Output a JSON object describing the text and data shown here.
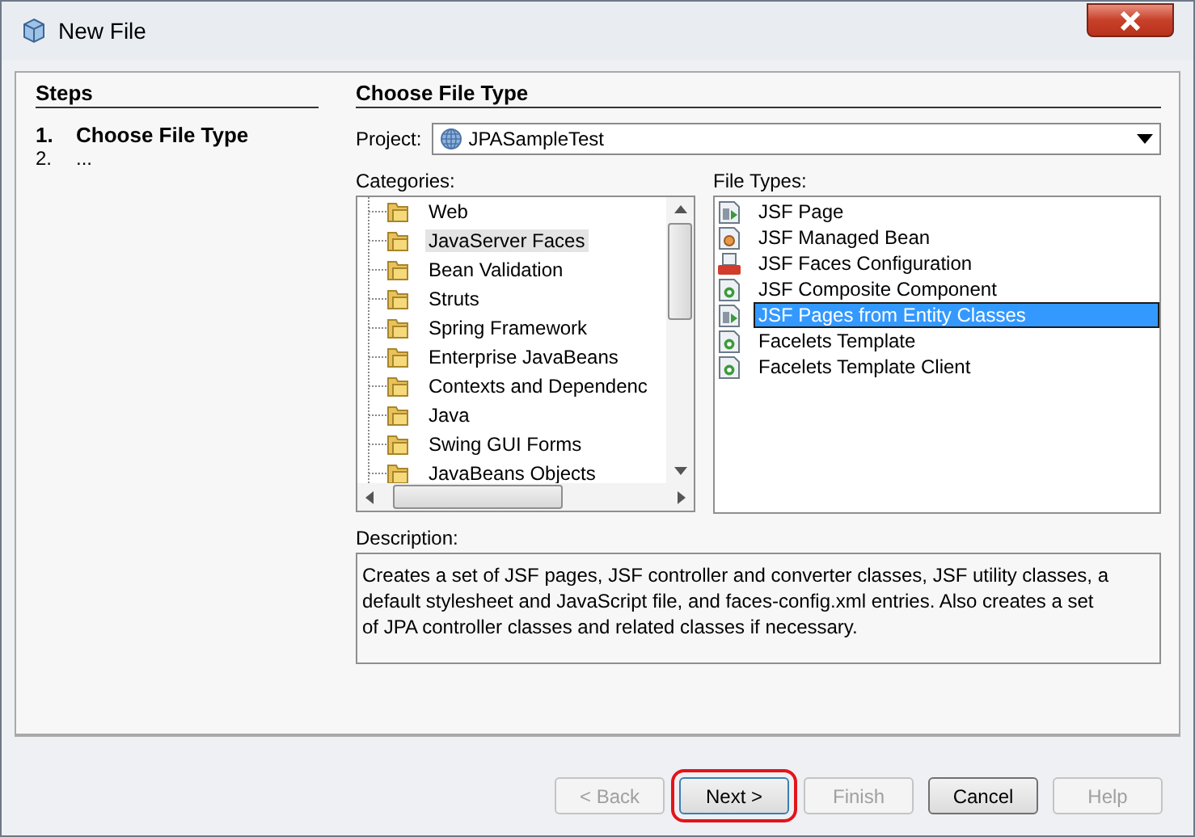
{
  "window": {
    "title": "New File"
  },
  "steps": {
    "title": "Steps",
    "items": [
      {
        "number": "1.",
        "label": "Choose File Type",
        "selected": true
      },
      {
        "number": "2.",
        "label": "...",
        "selected": false
      }
    ]
  },
  "panel_title": "Choose File Type",
  "project": {
    "label": "Project:",
    "value": "JPASampleTest"
  },
  "categories": {
    "label": "Categories:",
    "items": [
      {
        "label": "Web",
        "selected": false
      },
      {
        "label": "JavaServer Faces",
        "selected": true
      },
      {
        "label": "Bean Validation",
        "selected": false
      },
      {
        "label": "Struts",
        "selected": false
      },
      {
        "label": "Spring Framework",
        "selected": false
      },
      {
        "label": "Enterprise JavaBeans",
        "selected": false
      },
      {
        "label": "Contexts and Dependenc",
        "selected": false
      },
      {
        "label": "Java",
        "selected": false
      },
      {
        "label": "Swing GUI Forms",
        "selected": false
      },
      {
        "label": "JavaBeans Objects",
        "selected": false
      }
    ]
  },
  "file_types": {
    "label": "File Types:",
    "items": [
      {
        "label": "JSF Page",
        "kind": "page",
        "selected": false
      },
      {
        "label": "JSF Managed Bean",
        "kind": "bean",
        "selected": false
      },
      {
        "label": "JSF Faces Configuration",
        "kind": "config",
        "selected": false
      },
      {
        "label": "JSF Composite Component",
        "kind": "component",
        "selected": false
      },
      {
        "label": "JSF Pages from Entity Classes",
        "kind": "page",
        "selected": true
      },
      {
        "label": "Facelets Template",
        "kind": "component",
        "selected": false
      },
      {
        "label": "Facelets Template Client",
        "kind": "component",
        "selected": false
      }
    ]
  },
  "description": {
    "label": "Description:",
    "text": "Creates a set of JSF pages, JSF controller and converter classes, JSF utility classes, a default stylesheet and JavaScript file, and faces-config.xml entries. Also creates a set of JPA controller classes and related classes if necessary."
  },
  "buttons": [
    {
      "label": "< Back",
      "disabled": true,
      "highlighted": false
    },
    {
      "label": "Next >",
      "disabled": false,
      "highlighted": true
    },
    {
      "label": "Finish",
      "disabled": true,
      "highlighted": false
    },
    {
      "label": "Cancel",
      "disabled": false,
      "highlighted": false
    },
    {
      "label": "Help",
      "disabled": true,
      "highlighted": false
    }
  ]
}
